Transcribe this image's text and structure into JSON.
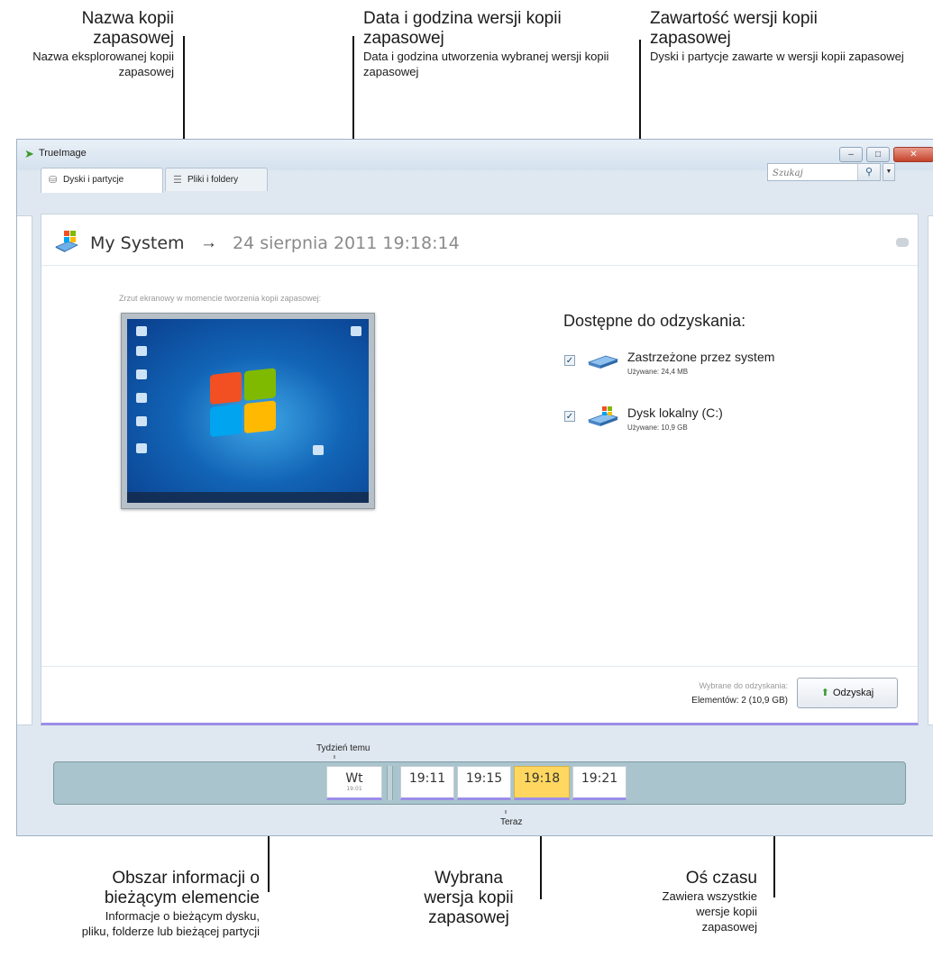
{
  "annotations": {
    "backup_name": {
      "title": "Nazwa kopii zapasowej",
      "desc": "Nazwa eksplorowanej kopii zapasowej"
    },
    "version_datetime": {
      "title": "Data i godzina wersji kopii zapasowej",
      "desc": "Data i godzina utworzenia wybranej wersji kopii zapasowej"
    },
    "version_contents": {
      "title": "Zawartość wersji kopii zapasowej",
      "desc": "Dyski i partycje zawarte w wersji kopii zapasowej"
    },
    "info_area": {
      "title": "Obszar informacji o bieżącym elemencie",
      "desc": "Informacje o bieżącym dysku, pliku, folderze lub bieżącej partycji"
    },
    "selected_version": {
      "title": "Wybrana wersja kopii zapasowej"
    },
    "timeline": {
      "title": "Oś czasu",
      "desc": "Zawiera wszystkie wersje kopii zapasowej"
    }
  },
  "window": {
    "title": "TrueImage",
    "buttons": {
      "minimize": "–",
      "maximize": "□",
      "close": "✕"
    }
  },
  "tabs": [
    {
      "label": "Dyski i partycje",
      "icon": "disk-icon",
      "active": true
    },
    {
      "label": "Pliki i foldery",
      "icon": "folder-list-icon",
      "active": false
    }
  ],
  "search": {
    "placeholder": "Szukaj"
  },
  "header": {
    "backup_name": "My System",
    "arrow": "→",
    "datetime": "24 sierpnia 2011 19:18:14"
  },
  "screenshot": {
    "caption": "Zrzut ekranowy w momencie tworzenia kopii zapasowej:"
  },
  "available": {
    "title": "Dostępne do odzyskania:",
    "items": [
      {
        "name": "Zastrzeżone przez system",
        "used": "Używane: 24,4 MB",
        "checked": true,
        "icon": "hard-drive-icon"
      },
      {
        "name": "Dysk lokalny (C:)",
        "used": "Używane: 10,9 GB",
        "checked": true,
        "icon": "windows-drive-icon"
      }
    ]
  },
  "footer": {
    "selected_label": "Wybrane do odzyskania:",
    "selected_value": "Elementów: 2 (10,9 GB)",
    "recover_button": "Odzyskaj"
  },
  "timeline": {
    "label_top": "Tydzień temu",
    "label_bottom": "Teraz",
    "day": {
      "label": "Wt",
      "sub": "19:01"
    },
    "versions": [
      "19:11",
      "19:15",
      "19:18",
      "19:21"
    ],
    "selected": "19:18"
  },
  "colors": {
    "accent": "#9a8ee8",
    "selected_version": "#ffd760",
    "timeline_bg": "#a9c4cd"
  }
}
